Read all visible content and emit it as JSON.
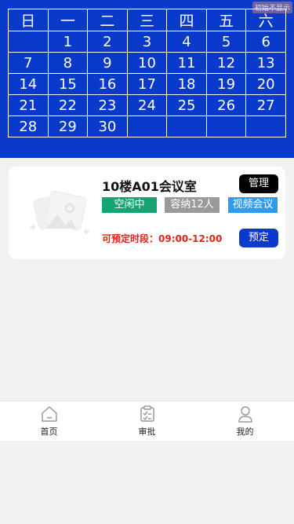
{
  "calendar": {
    "weekdays": [
      "日",
      "一",
      "二",
      "三",
      "四",
      "五",
      "六"
    ],
    "weeks": [
      [
        "",
        "1",
        "2",
        "3",
        "4",
        "5",
        "6"
      ],
      [
        "7",
        "8",
        "9",
        "10",
        "11",
        "12",
        "13"
      ],
      [
        "14",
        "15",
        "16",
        "17",
        "18",
        "19",
        "20"
      ],
      [
        "21",
        "22",
        "23",
        "24",
        "25",
        "26",
        "27"
      ],
      [
        "28",
        "29",
        "30",
        "",
        "",
        "",
        ""
      ]
    ]
  },
  "corner_badge": "初始不显示",
  "room": {
    "title": "10楼A01会议室",
    "manage_label": "管理",
    "status_tag": "空闲中",
    "capacity_tag": "容纳12人",
    "feature_tag": "视频会议",
    "time_label": "可预定时段：09:00-12:00",
    "book_label": "预定"
  },
  "tabbar": {
    "items": [
      {
        "label": "首页",
        "icon": "home-icon"
      },
      {
        "label": "审批",
        "icon": "clipboard-check-icon"
      },
      {
        "label": "我的",
        "icon": "user-icon"
      }
    ]
  },
  "colors": {
    "calendar_bg": "#0a3acb",
    "status_green": "#15a575",
    "capacity_gray": "#9a9a9a",
    "video_blue": "#2d9bef",
    "time_red": "#e2231a"
  }
}
